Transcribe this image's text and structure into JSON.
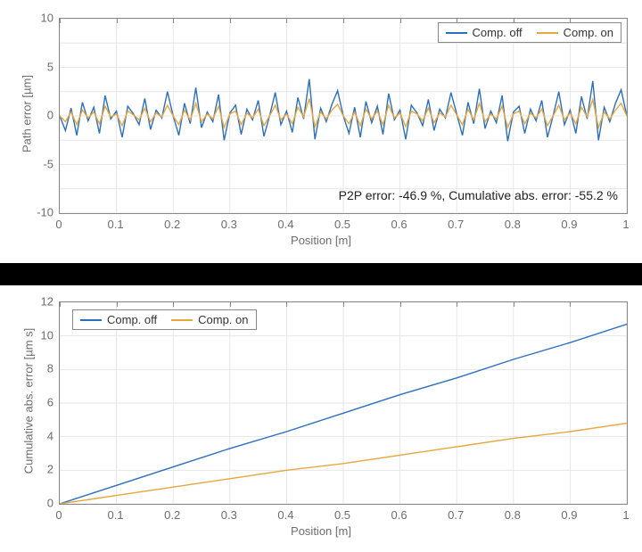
{
  "colors": {
    "series_off": "#2b6fbf",
    "series_on": "#e6a73e"
  },
  "legend": {
    "off": "Comp. off",
    "on": "Comp. on"
  },
  "top": {
    "xlabel": "Position [m]",
    "ylabel": "Path error [µm]",
    "annotation": "P2P error: -46.9 %, Cumulative abs. error: -55.2 %",
    "xticks": [
      "0",
      "0.1",
      "0.2",
      "0.3",
      "0.4",
      "0.5",
      "0.6",
      "0.7",
      "0.8",
      "0.9",
      "1"
    ],
    "yticks": [
      "-10",
      "-5",
      "0",
      "5",
      "10"
    ]
  },
  "bottom": {
    "xlabel": "Position [m]",
    "ylabel": "Cumulative abs. error [µm s]",
    "xticks": [
      "0",
      "0.1",
      "0.2",
      "0.3",
      "0.4",
      "0.5",
      "0.6",
      "0.7",
      "0.8",
      "0.9",
      "1"
    ],
    "yticks": [
      "0",
      "2",
      "4",
      "6",
      "8",
      "10",
      "12"
    ]
  },
  "chart_data": [
    {
      "type": "line",
      "title": "",
      "xlabel": "Position [m]",
      "ylabel": "Path error [µm]",
      "xlim": [
        0,
        1
      ],
      "ylim": [
        -10,
        10
      ],
      "legend_position": "top-right",
      "annotations": [
        "P2P error: -46.9 %, Cumulative abs. error: -55.2 %"
      ],
      "x": [
        0,
        0.01,
        0.02,
        0.03,
        0.04,
        0.05,
        0.06,
        0.07,
        0.08,
        0.09,
        0.1,
        0.11,
        0.12,
        0.13,
        0.14,
        0.15,
        0.16,
        0.17,
        0.18,
        0.19,
        0.2,
        0.21,
        0.22,
        0.23,
        0.24,
        0.25,
        0.26,
        0.27,
        0.28,
        0.29,
        0.3,
        0.31,
        0.32,
        0.33,
        0.34,
        0.35,
        0.36,
        0.37,
        0.38,
        0.39,
        0.4,
        0.41,
        0.42,
        0.43,
        0.44,
        0.45,
        0.46,
        0.47,
        0.48,
        0.49,
        0.5,
        0.51,
        0.52,
        0.53,
        0.54,
        0.55,
        0.56,
        0.57,
        0.58,
        0.59,
        0.6,
        0.61,
        0.62,
        0.63,
        0.64,
        0.65,
        0.66,
        0.67,
        0.68,
        0.69,
        0.7,
        0.71,
        0.72,
        0.73,
        0.74,
        0.75,
        0.76,
        0.77,
        0.78,
        0.79,
        0.8,
        0.81,
        0.82,
        0.83,
        0.84,
        0.85,
        0.86,
        0.87,
        0.88,
        0.89,
        0.9,
        0.91,
        0.92,
        0.93,
        0.94,
        0.95,
        0.96,
        0.97,
        0.98,
        0.99,
        1
      ],
      "series": [
        {
          "name": "Comp. off",
          "color": "#2b6fbf",
          "values": [
            0.0,
            -1.5,
            0.8,
            -2.0,
            1.4,
            -0.5,
            0.9,
            -1.8,
            2.1,
            -0.3,
            0.5,
            -2.2,
            1.0,
            0.2,
            -0.9,
            1.8,
            -1.4,
            0.6,
            -0.2,
            2.5,
            0.0,
            -2.0,
            1.3,
            -0.8,
            2.9,
            -1.2,
            0.4,
            -0.6,
            2.2,
            -2.5,
            0.3,
            1.1,
            -1.9,
            0.7,
            -0.4,
            1.6,
            -2.1,
            0.0,
            2.4,
            -0.9,
            0.5,
            -1.7,
            1.9,
            -0.3,
            3.8,
            -2.4,
            0.8,
            -0.6,
            1.2,
            2.6,
            0.0,
            -1.8,
            0.9,
            -2.2,
            1.5,
            -0.7,
            1.0,
            -1.9,
            2.3,
            -0.4,
            0.6,
            -2.4,
            1.1,
            0.3,
            -1.0,
            1.7,
            -1.5,
            0.7,
            -0.2,
            2.4,
            0.2,
            -2.0,
            1.4,
            -0.8,
            2.8,
            -1.3,
            0.5,
            -0.7,
            2.1,
            -2.6,
            0.4,
            1.0,
            -1.8,
            0.7,
            -0.5,
            1.6,
            -2.2,
            0.0,
            2.5,
            -0.9,
            0.6,
            -1.8,
            2.0,
            -0.3,
            3.6,
            -2.5,
            0.9,
            -0.6,
            1.3,
            2.7,
            0.0
          ]
        },
        {
          "name": "Comp. on",
          "color": "#e6a73e",
          "values": [
            0.0,
            -0.6,
            0.4,
            -0.9,
            0.6,
            -0.2,
            0.4,
            -0.8,
            1.0,
            -0.1,
            0.2,
            -1.0,
            0.5,
            0.1,
            -0.4,
            0.8,
            -0.6,
            0.3,
            -0.1,
            1.1,
            0.0,
            -0.9,
            0.6,
            -0.4,
            1.3,
            -0.6,
            0.2,
            -0.3,
            1.0,
            -1.2,
            0.2,
            0.5,
            -0.9,
            0.3,
            -0.2,
            0.7,
            -1.0,
            0.0,
            1.1,
            -0.4,
            0.2,
            -0.8,
            0.9,
            -0.1,
            1.8,
            -1.1,
            0.4,
            -0.3,
            0.6,
            1.2,
            0.0,
            -0.8,
            0.4,
            -1.0,
            0.7,
            -0.3,
            0.5,
            -0.9,
            1.1,
            -0.2,
            0.3,
            -1.1,
            0.5,
            0.2,
            -0.5,
            0.8,
            -0.7,
            0.3,
            -0.1,
            1.1,
            0.1,
            -0.9,
            0.7,
            -0.4,
            1.3,
            -0.6,
            0.2,
            -0.3,
            1.0,
            -1.2,
            0.2,
            0.5,
            -0.8,
            0.3,
            -0.2,
            0.7,
            -1.0,
            0.0,
            1.1,
            -0.4,
            0.3,
            -0.8,
            0.9,
            -0.1,
            1.7,
            -1.2,
            0.4,
            -0.3,
            0.6,
            1.3,
            0.0
          ]
        }
      ]
    },
    {
      "type": "line",
      "title": "",
      "xlabel": "Position [m]",
      "ylabel": "Cumulative abs. error [µm s]",
      "xlim": [
        0,
        1
      ],
      "ylim": [
        0,
        12
      ],
      "legend_position": "top-left-inset",
      "x": [
        0,
        0.1,
        0.2,
        0.3,
        0.4,
        0.5,
        0.6,
        0.7,
        0.8,
        0.9,
        1.0
      ],
      "series": [
        {
          "name": "Comp. off",
          "color": "#2b6fbf",
          "values": [
            0.0,
            1.1,
            2.2,
            3.3,
            4.3,
            5.4,
            6.5,
            7.5,
            8.6,
            9.6,
            10.7
          ]
        },
        {
          "name": "Comp. on",
          "color": "#e6a73e",
          "values": [
            0.0,
            0.5,
            1.0,
            1.5,
            2.0,
            2.4,
            2.9,
            3.4,
            3.9,
            4.3,
            4.8
          ]
        }
      ]
    }
  ]
}
